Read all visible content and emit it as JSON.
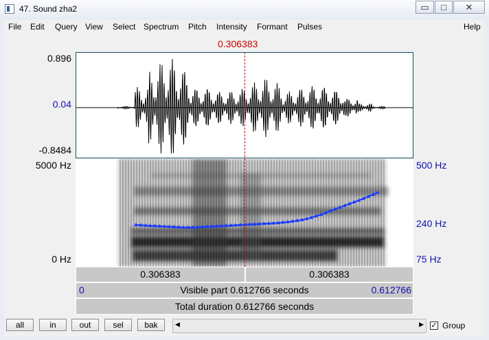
{
  "window": {
    "title": "47. Sound zha2",
    "min_glyph": "▭",
    "max_glyph": "□",
    "close_glyph": "✕"
  },
  "menu": [
    "File",
    "Edit",
    "Query",
    "View",
    "Select",
    "Spectrum",
    "Pitch",
    "Intensity",
    "Formant",
    "Pulses",
    "Help"
  ],
  "cursor_time": "0.306383",
  "waveform": {
    "ymax": "0.896",
    "ymid": "0.04",
    "ymin": "-0.8484"
  },
  "spectrogram": {
    "fmax": "5000 Hz",
    "fmin": "0 Hz",
    "pitch_top": "500 Hz",
    "pitch_mid": "240 Hz",
    "pitch_bottom": "75 Hz"
  },
  "pitch_contour_hz": [
    240,
    239,
    238,
    237,
    236,
    235,
    234,
    233,
    232,
    231,
    230,
    230,
    230,
    231,
    232,
    233,
    234,
    235,
    236,
    237,
    238,
    239,
    240,
    241,
    242,
    243,
    244,
    245,
    246,
    247,
    248,
    250,
    252,
    254,
    257,
    260,
    264,
    269,
    275,
    281,
    288,
    295,
    302,
    309,
    316,
    323,
    330,
    337,
    344,
    352,
    360,
    368
  ],
  "selection": {
    "left": "0.306383",
    "right": "0.306383"
  },
  "visible": {
    "start": "0",
    "label": "Visible part 0.612766 seconds",
    "end": "0.612766"
  },
  "total": "Total duration 0.612766 seconds",
  "buttons": {
    "all": "all",
    "in": "in",
    "out": "out",
    "sel": "sel",
    "bak": "bak"
  },
  "group_label": "Group",
  "group_checked": "✓",
  "scroll_left": "◀",
  "scroll_right": "▶",
  "colors": {
    "cursor": "#cc0000",
    "pitch": "#1a3cff",
    "axis_blue": "#1010b0"
  }
}
